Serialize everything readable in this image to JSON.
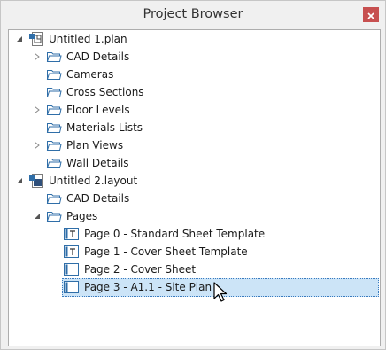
{
  "window": {
    "title": "Project Browser"
  },
  "tree": {
    "plan": {
      "label": "Untitled 1.plan",
      "children": [
        "CAD Details",
        "Cameras",
        "Cross Sections",
        "Floor Levels",
        "Materials Lists",
        "Plan Views",
        "Wall Details"
      ]
    },
    "layout": {
      "label": "Untitled 2.layout",
      "children": [
        "CAD Details",
        "Pages"
      ],
      "pages": [
        "Page 0 - Standard Sheet Template",
        "Page 1 - Cover Sheet Template",
        "Page 2 - Cover Sheet",
        "Page 3 - A1.1 - Site Plan"
      ]
    }
  },
  "selected_item": "Page 3 - A1.1 - Site Plan",
  "colors": {
    "selection": "#cce4f7",
    "close_button": "#c75050",
    "folder_outline": "#2f6ea8"
  },
  "icons": {
    "close": "close-icon",
    "plan_file": "plan-file-icon",
    "layout_file": "layout-file-icon",
    "folder": "folder-icon",
    "template_page": "template-page-icon",
    "page": "page-icon",
    "expanded": "expanded-triangle-icon",
    "collapsed": "collapsed-triangle-icon",
    "cursor": "mouse-cursor-icon"
  }
}
